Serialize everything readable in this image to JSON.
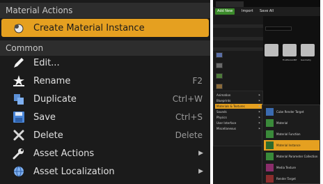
{
  "context_menu": {
    "section_material_actions": "Material Actions",
    "create_material_instance": "Create Material Instance",
    "section_common": "Common",
    "items": [
      {
        "label": "Edit...",
        "shortcut": "",
        "icon": "pencil-icon"
      },
      {
        "label": "Rename",
        "shortcut": "F2",
        "icon": "star-rename-icon"
      },
      {
        "label": "Duplicate",
        "shortcut": "Ctrl+W",
        "icon": "duplicate-icon"
      },
      {
        "label": "Save",
        "shortcut": "Ctrl+S",
        "icon": "floppy-disk-icon"
      },
      {
        "label": "Delete",
        "shortcut": "Delete",
        "icon": "x-delete-icon"
      },
      {
        "label": "Asset Actions",
        "shortcut": "",
        "icon": "wrench-icon",
        "submenu": true
      },
      {
        "label": "Asset Localization",
        "shortcut": "",
        "icon": "globe-icon",
        "submenu": true
      }
    ],
    "highlight_color": "#e5a020"
  },
  "editor": {
    "toolbar": {
      "add_new": "Add New",
      "import": "Import",
      "save_all": "Save All"
    },
    "folders": [
      {
        "label": ""
      },
      {
        "label": "FirstPersonBP"
      },
      {
        "label": "Geometry"
      }
    ],
    "submenu": [
      {
        "label": "Animation"
      },
      {
        "label": "Blueprints"
      },
      {
        "label": "Materials & Textures"
      },
      {
        "label": "Sounds"
      },
      {
        "label": "Physics"
      },
      {
        "label": "User Interface"
      },
      {
        "label": "Miscellaneous"
      }
    ],
    "flyout": [
      {
        "label": "Cube Render Target"
      },
      {
        "label": "Material"
      },
      {
        "label": "Material Function"
      },
      {
        "label": "Material Instance"
      },
      {
        "label": "Material Parameter Collection"
      },
      {
        "label": "Media Texture"
      },
      {
        "label": "Render Target"
      }
    ]
  }
}
